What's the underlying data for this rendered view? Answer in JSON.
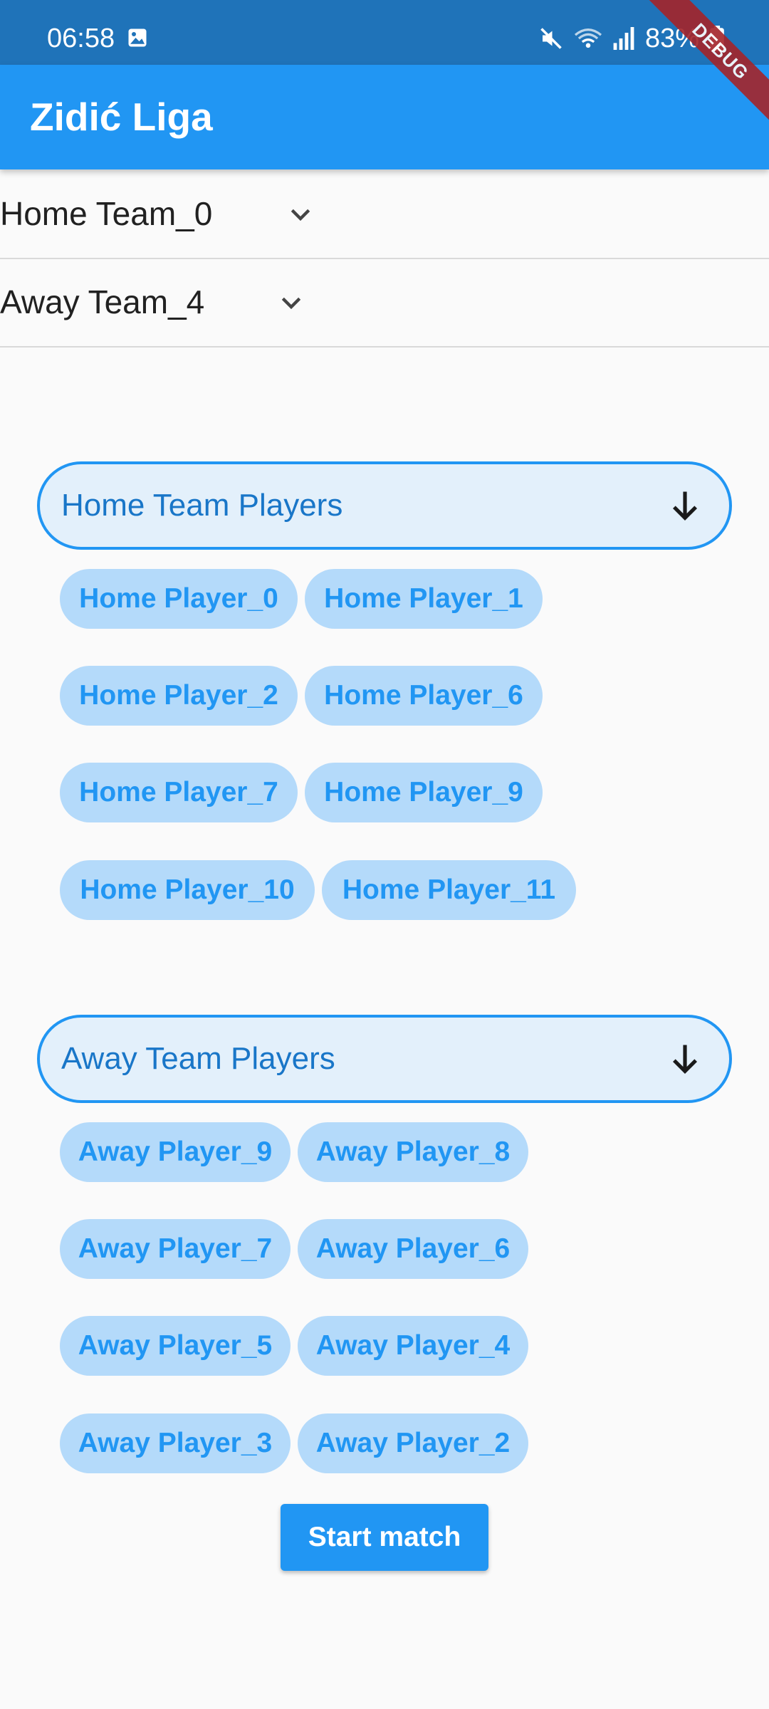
{
  "status_bar": {
    "time": "06:58",
    "battery": "83%",
    "icons": [
      "gallery-icon",
      "mute-icon",
      "wifi-icon",
      "signal-icon",
      "battery-icon"
    ]
  },
  "debug_banner": "DEBUG",
  "app_bar": {
    "title": "Zidić Liga"
  },
  "home_team_select": {
    "value": "Home Team_0"
  },
  "away_team_select": {
    "value": "Away Team_4"
  },
  "home_section": {
    "title": "Home Team Players",
    "players": [
      "Home Player_0",
      "Home Player_1",
      "Home Player_2",
      "Home Player_6",
      "Home Player_7",
      "Home Player_9",
      "Home Player_10",
      "Home Player_11"
    ]
  },
  "away_section": {
    "title": "Away Team Players",
    "players": [
      "Away Player_9",
      "Away Player_8",
      "Away Player_7",
      "Away Player_6",
      "Away Player_5",
      "Away Player_4",
      "Away Player_3",
      "Away Player_2"
    ]
  },
  "actions": {
    "start_label": "Start match"
  },
  "colors": {
    "primary": "#2196f3",
    "status_bar": "#1f73b9",
    "chip_bg": "#b4dafa",
    "section_bg": "#e3f0fb",
    "debug": "#a4242a"
  }
}
